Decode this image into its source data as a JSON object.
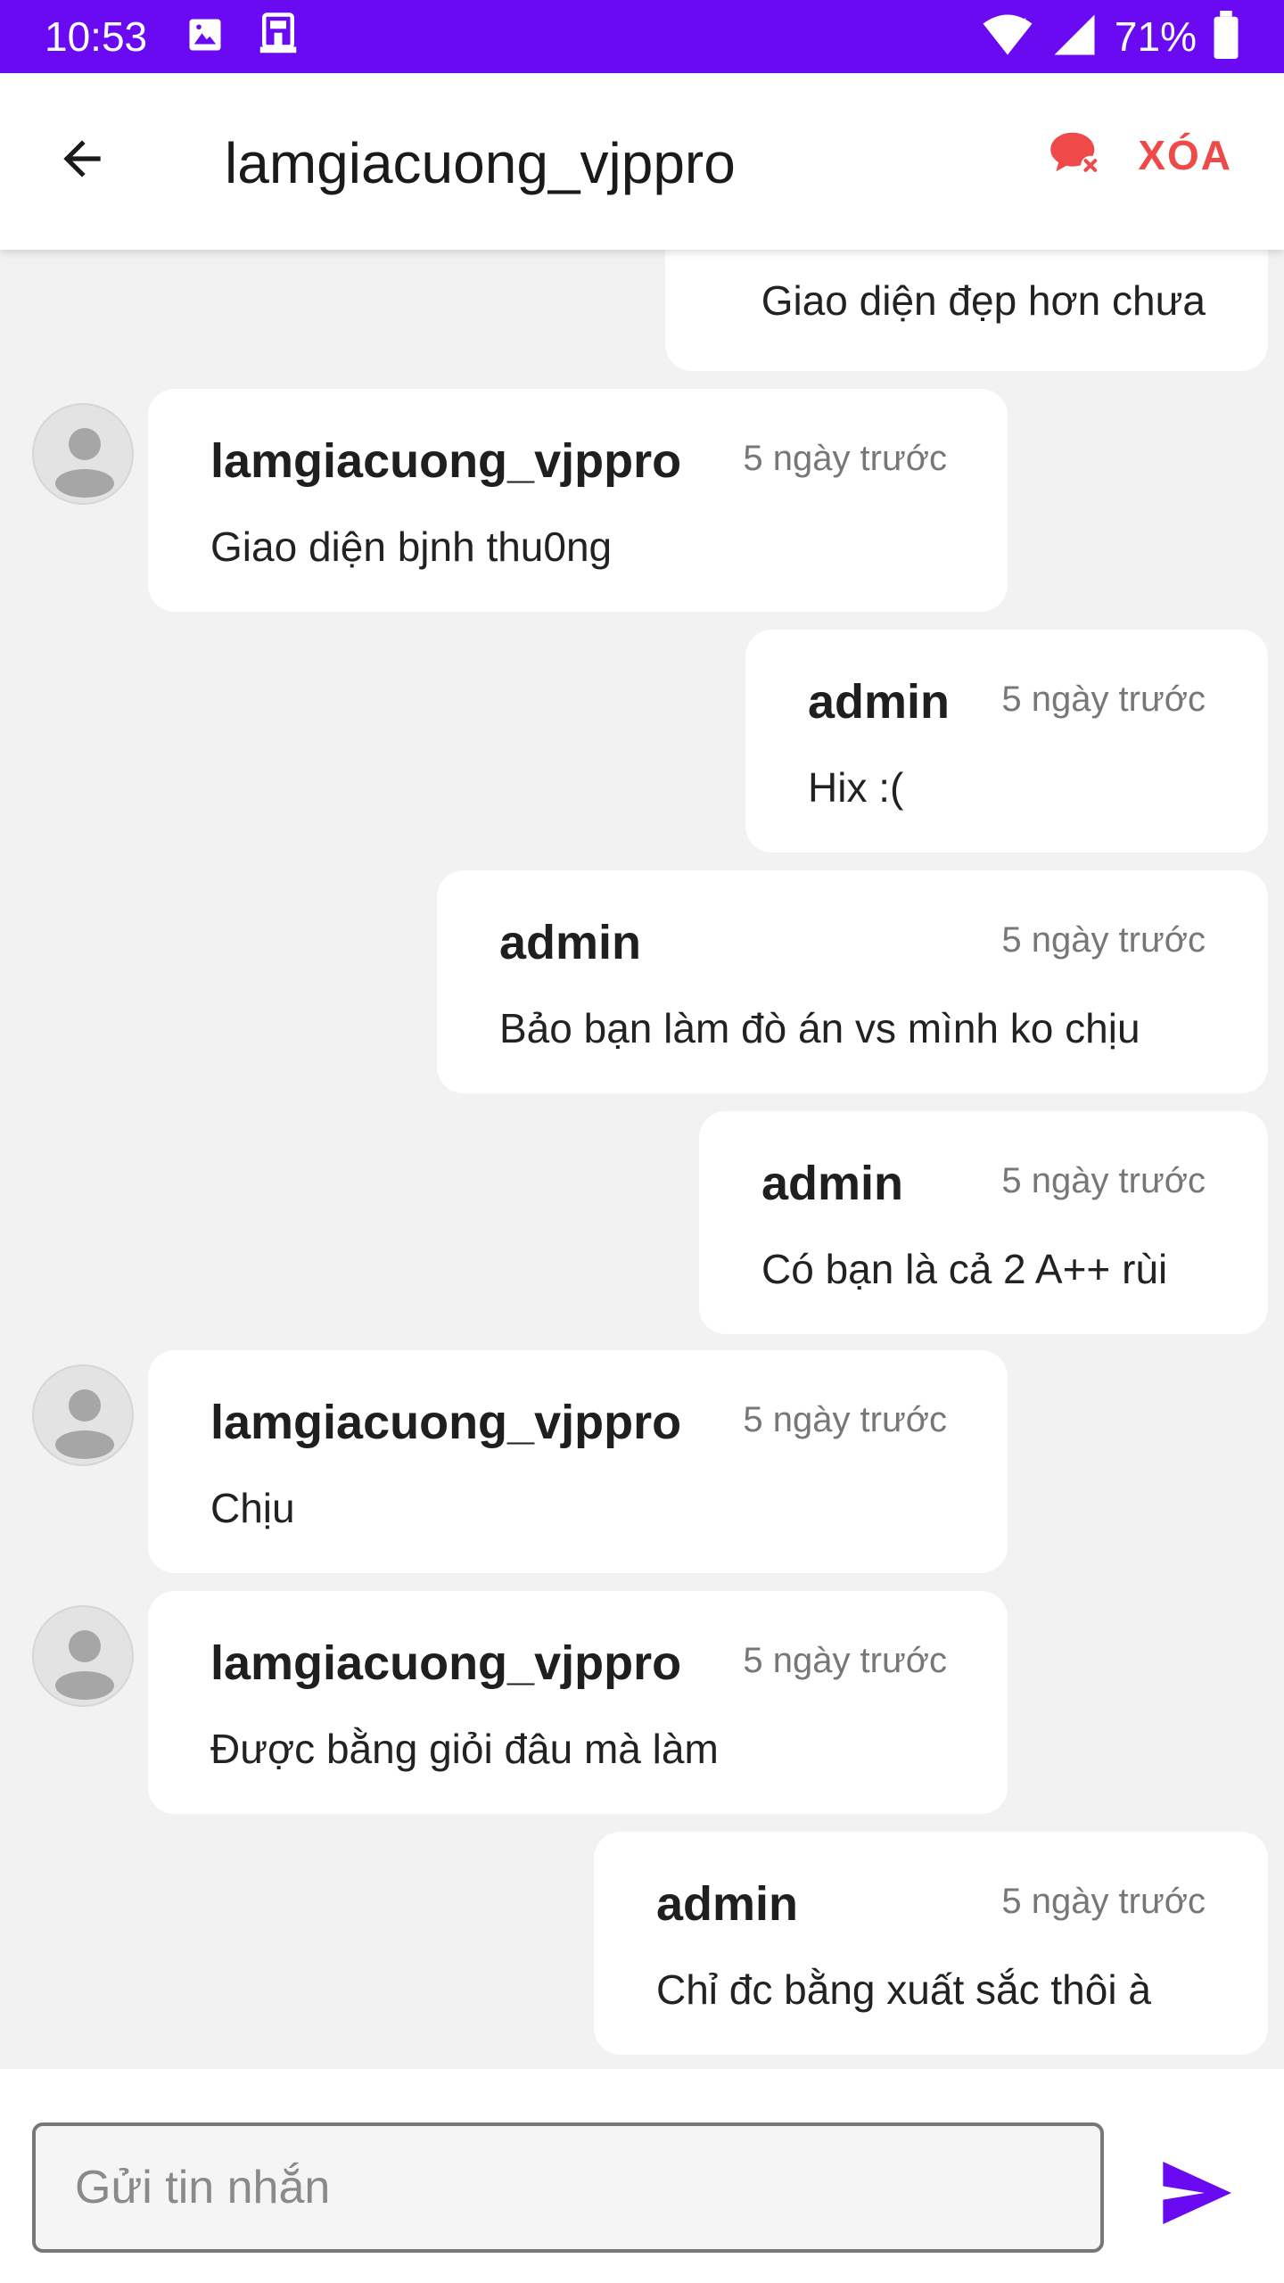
{
  "status_bar": {
    "time": "10:53",
    "battery": "71%",
    "icons": [
      "image-icon",
      "cast-icon",
      "wifi-icon",
      "signal-icon",
      "battery-icon"
    ]
  },
  "toolbar": {
    "title": "lamgiacuong_vjppro",
    "delete_label": "XÓA",
    "back_icon": "arrow-back-icon",
    "delete_icon": "chat-delete-icon"
  },
  "messages": [
    {
      "sender": "",
      "time": "",
      "text": "Giao diện đẹp hơn chưa",
      "mine": true
    },
    {
      "sender": "lamgiacuong_vjppro",
      "time": "5 ngày trước",
      "text": "Giao diện bjnh thu0ng",
      "mine": false
    },
    {
      "sender": "admin",
      "time": "5 ngày trước",
      "text": "Hix :(",
      "mine": true
    },
    {
      "sender": "admin",
      "time": "5 ngày trước",
      "text": "Bảo bạn làm đò án vs mình ko chịu",
      "mine": true
    },
    {
      "sender": "admin",
      "time": "5 ngày trước",
      "text": "Có bạn là cả 2 A++ rùi",
      "mine": true
    },
    {
      "sender": "lamgiacuong_vjppro",
      "time": "5 ngày trước",
      "text": "Chịu",
      "mine": false
    },
    {
      "sender": "lamgiacuong_vjppro",
      "time": "5 ngày trước",
      "text": "Được bằng giỏi đâu mà làm",
      "mine": false
    },
    {
      "sender": "admin",
      "time": "5 ngày trước",
      "text": "Chỉ đc bằng xuất sắc thôi à",
      "mine": true
    }
  ],
  "composer": {
    "placeholder": "Gửi tin nhắn",
    "value": "",
    "send_icon": "send-icon"
  },
  "colors": {
    "primary": "#6a0af2",
    "danger": "#ef4a4a",
    "background": "#f2f2f2",
    "bubble": "#ffffff"
  }
}
